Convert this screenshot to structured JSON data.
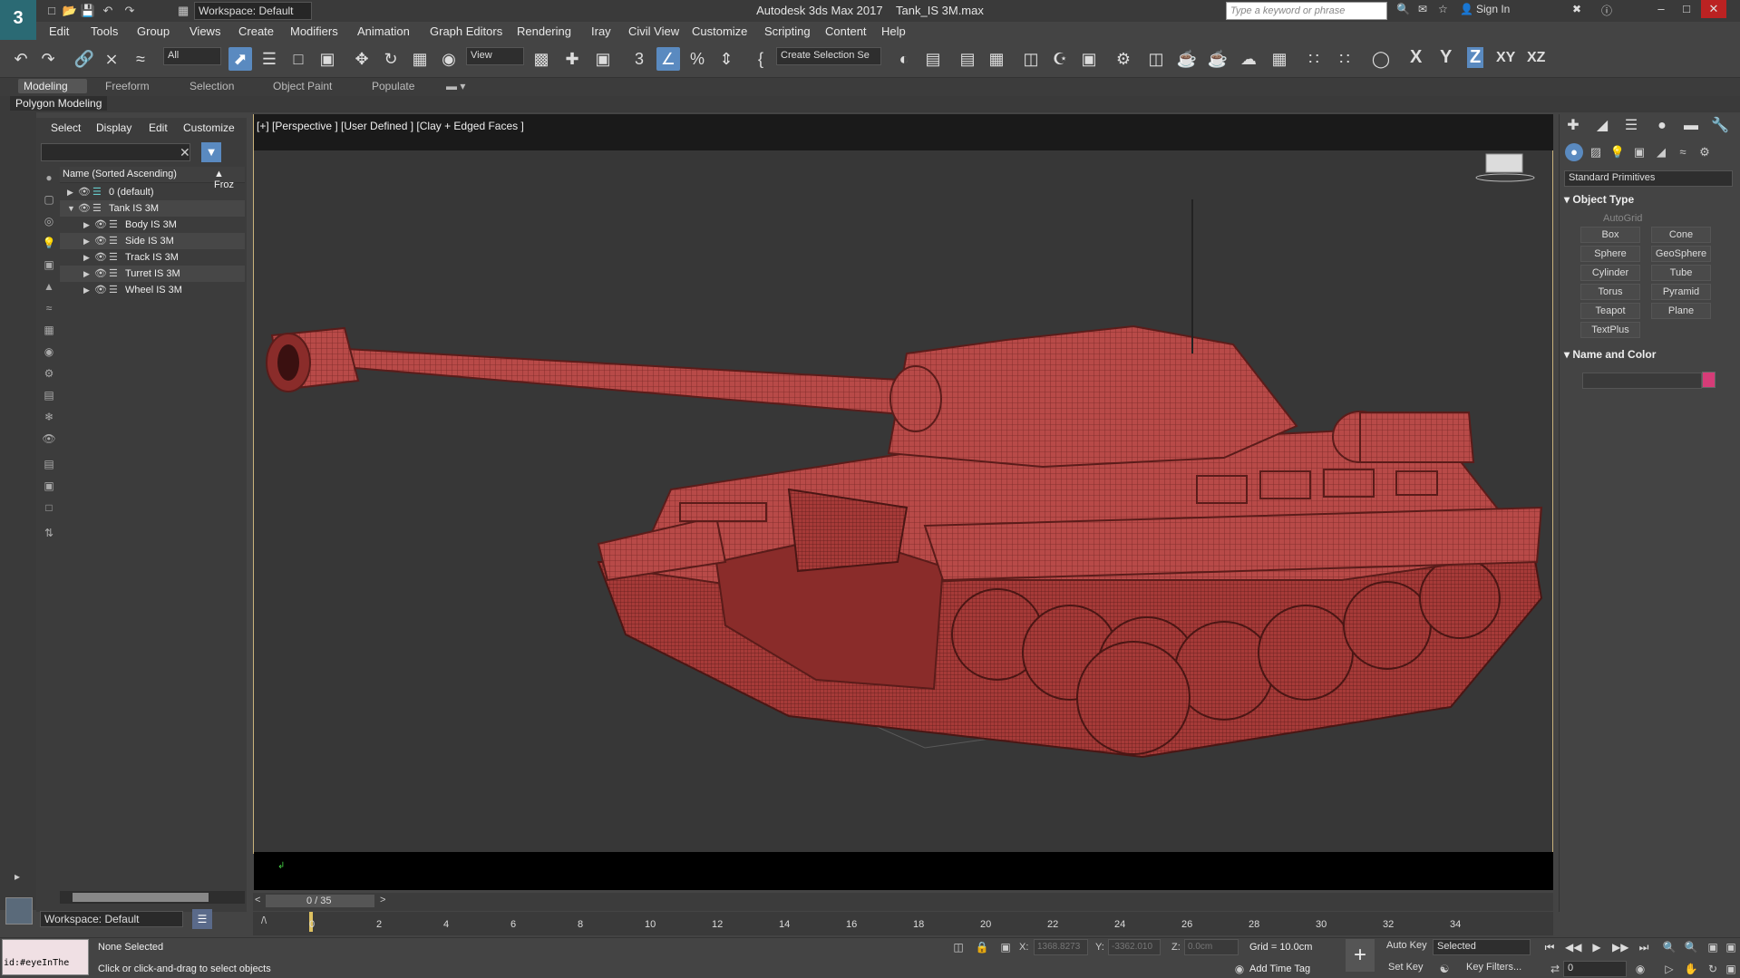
{
  "title": {
    "app": "Autodesk 3ds Max 2017",
    "file": "Tank_IS 3M.max",
    "workspace": "Workspace: Default",
    "search_placeholder": "Type a keyword or phrase",
    "sign_in": "Sign In"
  },
  "menu": [
    "Edit",
    "Tools",
    "Group",
    "Views",
    "Create",
    "Modifiers",
    "Animation",
    "Graph Editors",
    "Rendering",
    "Iray",
    "Civil View",
    "Customize",
    "Scripting",
    "Content",
    "Help"
  ],
  "toolbar": {
    "filter": "All",
    "coord_system": "View",
    "selection_set": "Create Selection Se",
    "axis_labels": [
      "X",
      "Y",
      "Z",
      "XY",
      "XZ"
    ]
  },
  "ribbon": {
    "tabs": [
      "Modeling",
      "Freeform",
      "Selection",
      "Object Paint",
      "Populate"
    ],
    "sub": "Polygon Modeling"
  },
  "scene_explorer": {
    "menus": [
      "Select",
      "Display",
      "Edit",
      "Customize"
    ],
    "column": "Name (Sorted Ascending)",
    "column2": "▲ Froz",
    "rows": [
      {
        "label": "0 (default)",
        "level": 0,
        "expanded": false
      },
      {
        "label": "Tank IS 3M",
        "level": 0,
        "expanded": true
      },
      {
        "label": "Body IS 3M",
        "level": 1,
        "expanded": false
      },
      {
        "label": "Side IS 3M",
        "level": 1,
        "expanded": false
      },
      {
        "label": "Track IS 3M",
        "level": 1,
        "expanded": false
      },
      {
        "label": "Turret IS 3M",
        "level": 1,
        "expanded": false
      },
      {
        "label": "Wheel IS 3M",
        "level": 1,
        "expanded": false
      }
    ],
    "workspace": "Workspace: Default"
  },
  "viewport": {
    "label": "[+] [Perspective ] [User Defined ] [Clay + Edged Faces ]"
  },
  "command_panel": {
    "category": "Standard Primitives",
    "object_type": "Object Type",
    "autogrid": "AutoGrid",
    "buttons": [
      "Box",
      "Cone",
      "Sphere",
      "GeoSphere",
      "Cylinder",
      "Tube",
      "Torus",
      "Pyramid",
      "Teapot",
      "Plane",
      "TextPlus"
    ],
    "name_color": "Name and Color",
    "object_color": "#d63c78"
  },
  "timeline": {
    "frame": "0 / 35",
    "ticks": [
      "0",
      "2",
      "4",
      "6",
      "8",
      "10",
      "12",
      "14",
      "16",
      "18",
      "20",
      "22",
      "24",
      "26",
      "28",
      "30",
      "32",
      "34"
    ]
  },
  "status": {
    "maxscript": "id:#eyeInThe",
    "selected": "None Selected",
    "hint": "Click or click-and-drag to select objects",
    "x_label": "X:",
    "x": "1368.8273",
    "y_label": "Y:",
    "y": "-3362.010",
    "z_label": "Z:",
    "z": "0.0cm",
    "grid": "Grid = 10.0cm",
    "add_time_tag": "Add Time Tag",
    "auto_key": "Auto Key",
    "set_key": "Set Key",
    "selected_dd": "Selected",
    "key_filters": "Key Filters...",
    "frame_value": "0"
  }
}
